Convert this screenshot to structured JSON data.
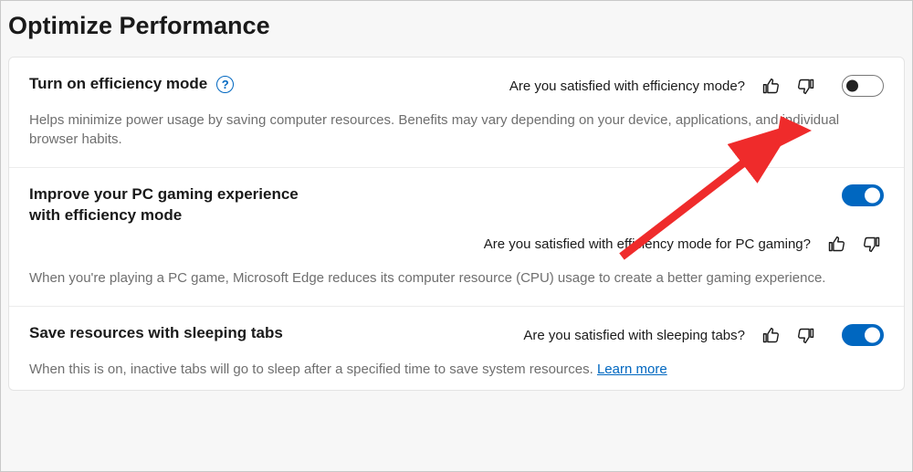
{
  "page": {
    "title": "Optimize Performance"
  },
  "settings": [
    {
      "title": "Turn on efficiency mode",
      "help": true,
      "feedback_q": "Are you satisfied with efficiency mode?",
      "toggle": "off",
      "desc": "Helps minimize power usage by saving computer resources. Benefits may vary depending on your device, applications, and individual browser habits."
    },
    {
      "title": "Improve your PC gaming experience with efficiency mode",
      "help": false,
      "feedback_q": "Are you satisfied with efficiency mode for PC gaming?",
      "toggle": "on",
      "desc": "When you're playing a PC game, Microsoft Edge reduces its computer resource (CPU) usage to create a better gaming experience."
    },
    {
      "title": "Save resources with sleeping tabs",
      "help": false,
      "feedback_q": "Are you satisfied with sleeping tabs?",
      "toggle": "on",
      "desc": "When this is on, inactive tabs will go to sleep after a specified time to save system resources.",
      "learn_more": "Learn more"
    }
  ],
  "annotation": {
    "arrow_color": "#ef2b2b"
  }
}
